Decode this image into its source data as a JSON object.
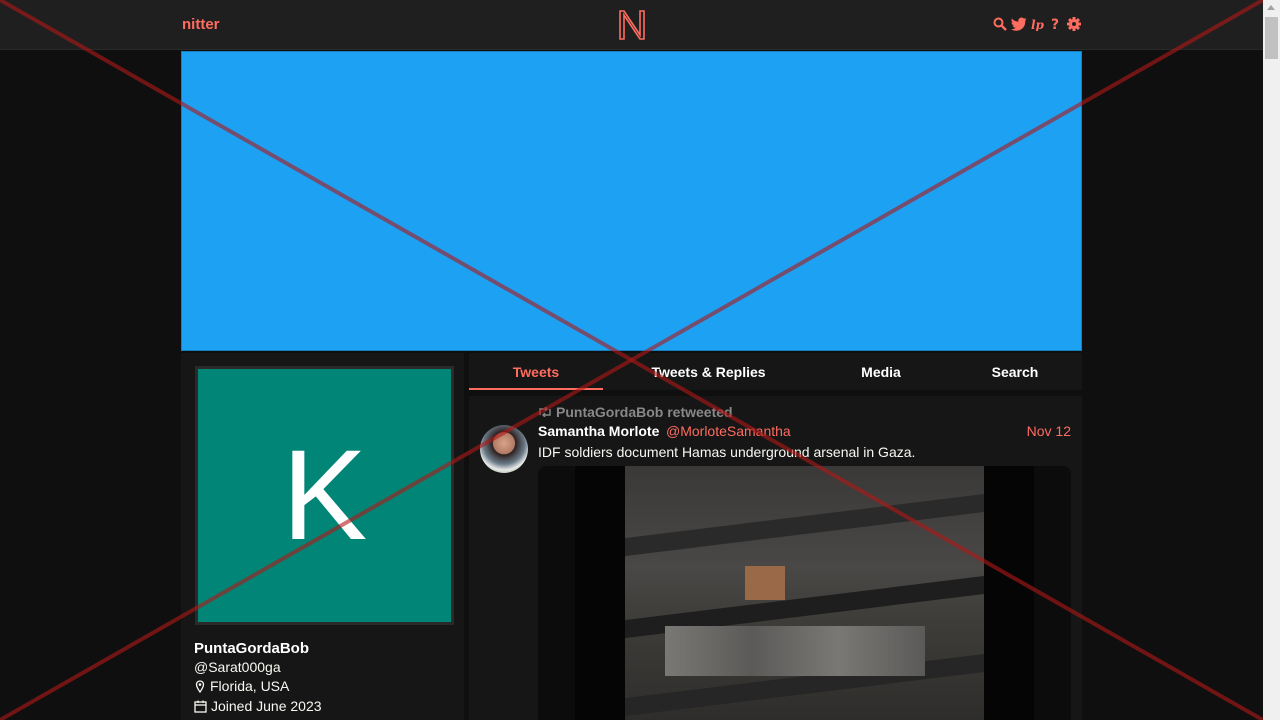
{
  "navbar": {
    "brand": "nitter",
    "logo_letter": "N",
    "icons": [
      "search-icon",
      "twitter-bird-icon",
      "liberapay-icon",
      "help-icon",
      "gear-icon"
    ]
  },
  "colors": {
    "accent": "#ff6c60",
    "banner": "#1da1f2",
    "avatar_bg": "#008577",
    "background": "#0f0f0f",
    "panel": "#161616",
    "muted": "#888889"
  },
  "profile": {
    "avatar_letter": "K",
    "fullname": "PuntaGordaBob",
    "username": "@Sarat000ga",
    "location": "Florida, USA",
    "joined": "Joined June 2023"
  },
  "tabs": [
    {
      "label": "Tweets",
      "active": true
    },
    {
      "label": "Tweets & Replies",
      "active": false
    },
    {
      "label": "Media",
      "active": false
    },
    {
      "label": "Search",
      "active": false
    }
  ],
  "tweet": {
    "retweet_header": "PuntaGordaBob retweeted",
    "fullname": "Samantha Morlote",
    "username": "@MorloteSamantha",
    "date": "Nov 12",
    "text": "IDF soldiers document Hamas underground arsenal in Gaza."
  }
}
